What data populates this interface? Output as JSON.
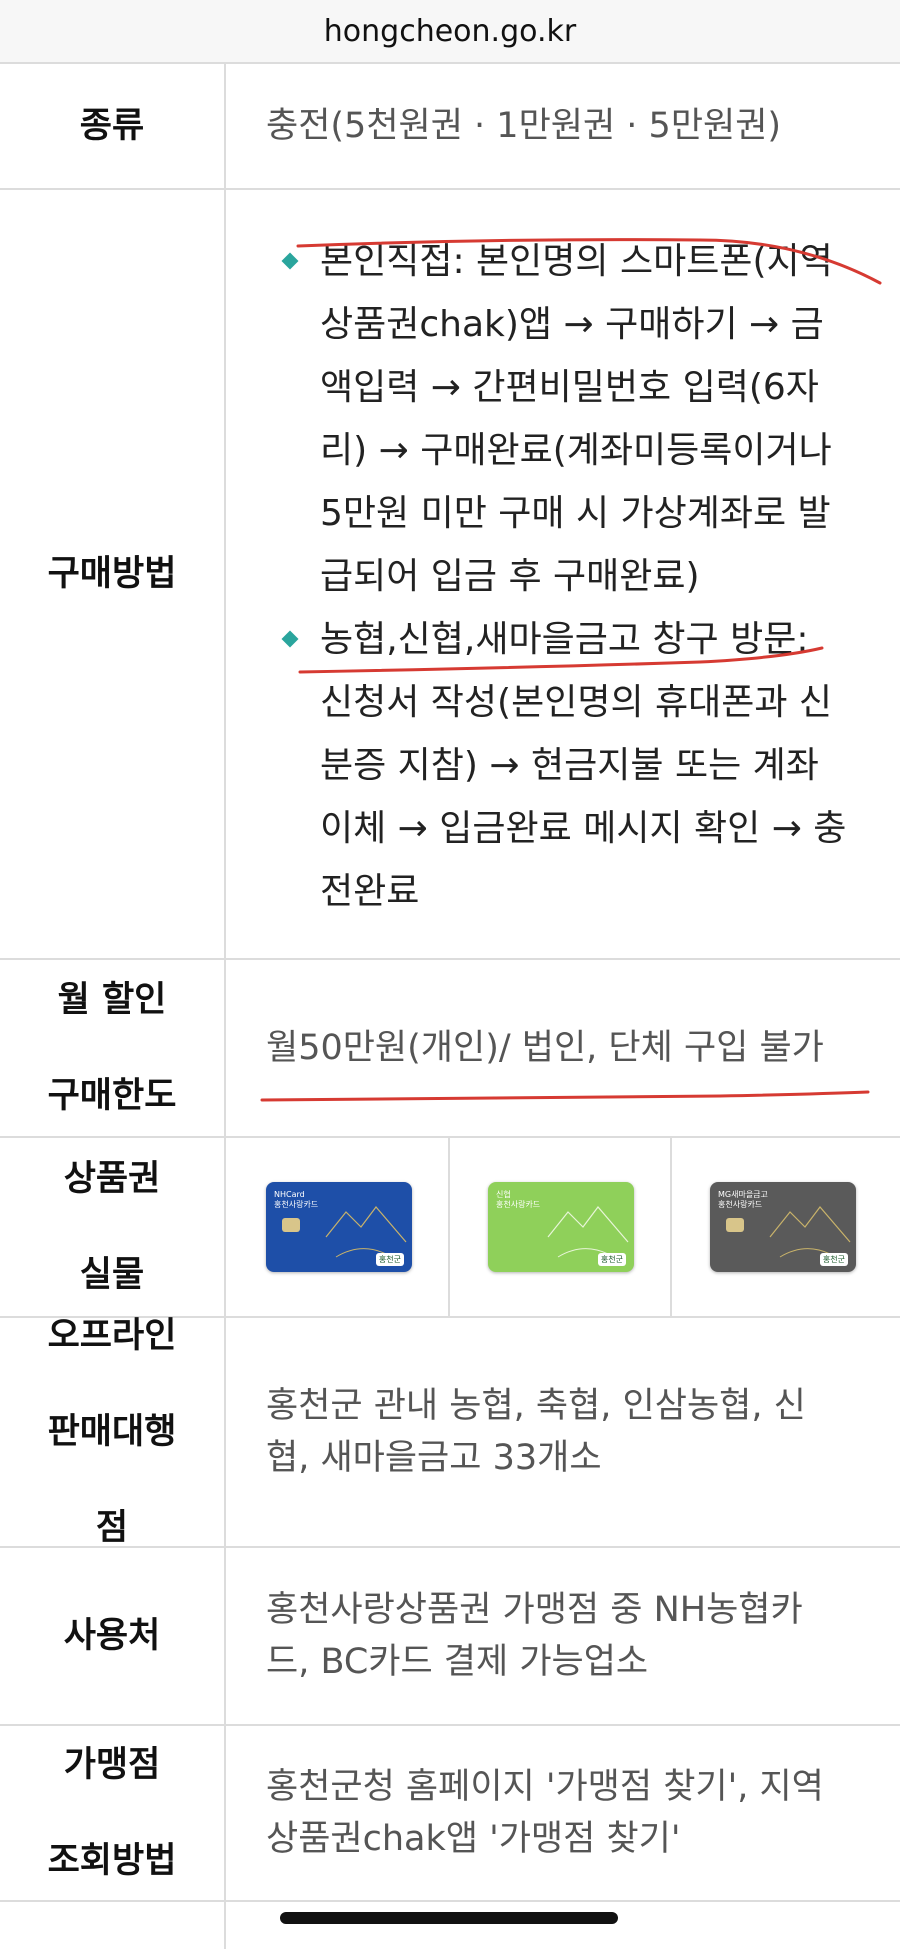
{
  "browser": {
    "url": "hongcheon.go.kr"
  },
  "table": {
    "kind": {
      "label": "종류",
      "value": "충전(5천원권 · 1만원권 · 5만원권)"
    },
    "method": {
      "label": "구매방법",
      "items": [
        {
          "lines": [
            "본인직접: 본인명의 스마트폰(지역",
            "상품권chak)앱 → 구매하기 → 금",
            "액입력 → 간편비밀번호 입력(6자",
            "리) → 구매완료(계좌미등록이거나",
            "5만원 미만 구매 시 가상계좌로 발",
            "급되어 입금 후 구매완료)"
          ]
        },
        {
          "lines": [
            "농협,신협,새마을금고 창구 방문:",
            "신청서 작성(본인명의 휴대폰과 신",
            "분증 지참) → 현금지불 또는 계좌",
            "이체 → 입금완료 메시지 확인 → 충",
            "전완료"
          ]
        }
      ]
    },
    "limit": {
      "label_lines": [
        "월 할인",
        "구매한도"
      ],
      "value": "월50만원(개인)/ 법인, 단체 구입 불가"
    },
    "cards": {
      "label_lines": [
        "상품권",
        "실물"
      ],
      "items": [
        {
          "brand": "NHCard",
          "title": "홍천사랑카드",
          "logo": "홍천군",
          "color": "#1e4fa8",
          "icon": "card-blue-icon"
        },
        {
          "brand": "신협",
          "title": "홍천사랑카드",
          "logo": "홍천군",
          "color": "#8fd05a",
          "icon": "card-green-icon"
        },
        {
          "brand": "MG새마을금고",
          "title": "홍천사랑카드",
          "logo": "홍천군",
          "color": "#5a5a5a",
          "icon": "card-gray-icon"
        }
      ]
    },
    "offline": {
      "label_lines": [
        "오프라인",
        "판매대행",
        "점"
      ],
      "value_lines": [
        "홍천군 관내 농협, 축협, 인삼농협, 신",
        "협, 새마을금고 33개소"
      ]
    },
    "usage": {
      "label": "사용처",
      "value_lines": [
        "홍천사랑상품권 가맹점 중 NH농협카",
        "드, BC카드 결제 가능업소"
      ]
    },
    "lookup": {
      "label_lines": [
        "가맹점",
        "조회방법"
      ],
      "value_lines": [
        "홍천군청 홈페이지 '가맹점 찾기', 지역",
        "상품권chak앱 '가맹점 찾기'"
      ]
    }
  },
  "annotation_color": "#d63a32"
}
